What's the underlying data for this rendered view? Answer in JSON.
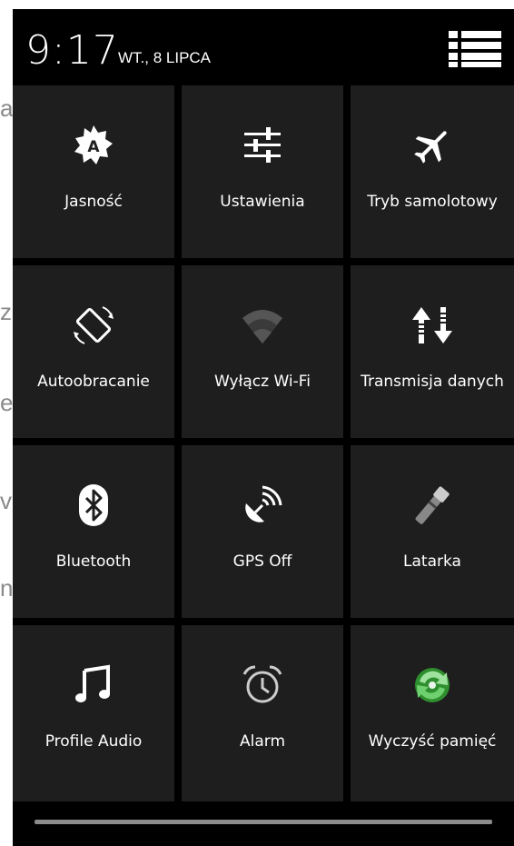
{
  "background_app": {
    "fragments": [
      "atus",
      "zum",
      "e",
      "viert",
      "n."
    ]
  },
  "status": {
    "time": "9:17",
    "date": "WT., 8 LIPCA"
  },
  "tiles": [
    {
      "label": "Jasność",
      "icon": "brightness-auto-icon"
    },
    {
      "label": "Ustawienia",
      "icon": "settings-sliders-icon"
    },
    {
      "label": "Tryb samolotowy",
      "icon": "airplane-icon"
    },
    {
      "label": "Autoobracanie",
      "icon": "auto-rotate-icon"
    },
    {
      "label": "Wyłącz Wi-Fi",
      "icon": "wifi-icon"
    },
    {
      "label": "Transmisja danych",
      "icon": "data-transfer-icon"
    },
    {
      "label": "Bluetooth",
      "icon": "bluetooth-icon"
    },
    {
      "label": "GPS Off",
      "icon": "gps-satellite-icon"
    },
    {
      "label": "Latarka",
      "icon": "flashlight-icon"
    },
    {
      "label": "Profile Audio",
      "icon": "music-note-icon"
    },
    {
      "label": "Alarm",
      "icon": "alarm-clock-icon"
    },
    {
      "label": "Wyczyść pamięć",
      "icon": "clean-memory-icon"
    }
  ],
  "colors": {
    "panel_bg": "#000000",
    "tile_bg": "#1e1e1e",
    "wifi_dim": "#555555",
    "clean_green": "#3cb43c"
  }
}
